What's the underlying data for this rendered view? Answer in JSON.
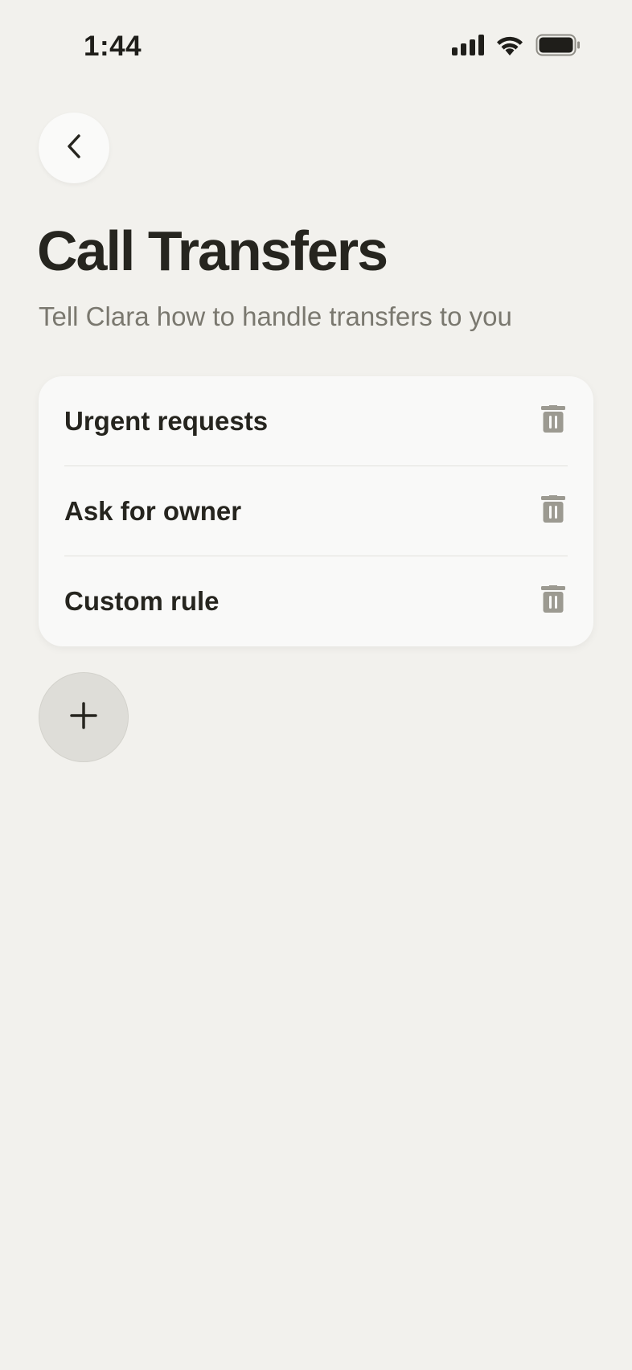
{
  "status_bar": {
    "time": "1:44",
    "icons": [
      "cellular-signal-icon",
      "wifi-icon",
      "battery-icon"
    ]
  },
  "header": {
    "back_icon": "chevron-left-icon",
    "title": "Call Transfers",
    "subtitle": "Tell Clara how to handle transfers to you"
  },
  "rules": [
    {
      "label": "Urgent requests",
      "action_icon": "trash-icon"
    },
    {
      "label": "Ask for owner",
      "action_icon": "trash-icon"
    },
    {
      "label": "Custom rule",
      "action_icon": "trash-icon"
    }
  ],
  "add_button": {
    "icon": "plus-icon"
  },
  "colors": {
    "background": "#f2f1ed",
    "card": "#f9f9f8",
    "text_primary": "#26251f",
    "text_secondary": "#7a786f",
    "icon_muted": "#9c9a91",
    "add_button_bg": "#deddd8"
  }
}
